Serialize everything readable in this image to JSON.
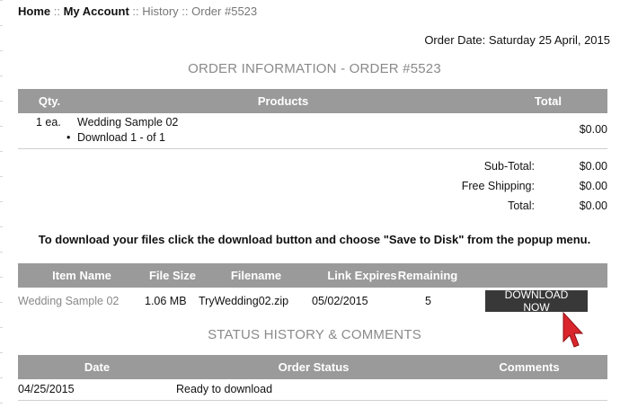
{
  "breadcrumb": {
    "home": "Home",
    "sep1": " :: ",
    "my_account": "My Account",
    "sep2": " :: ",
    "history": "History",
    "sep3": " :: ",
    "order": "Order #5523"
  },
  "order_date": "Order Date: Saturday 25 April, 2015",
  "order_info_title": "ORDER INFORMATION - ORDER #5523",
  "products_table": {
    "headers": {
      "qty": "Qty.",
      "products": "Products",
      "total": "Total"
    },
    "row": {
      "qty": "1 ea.",
      "name": "Wedding Sample 02",
      "bullet": "•",
      "sub": "Download 1 - of 1",
      "total": "$0.00"
    }
  },
  "totals": [
    {
      "label": "Sub-Total:",
      "value": "$0.00"
    },
    {
      "label": "Free Shipping:",
      "value": "$0.00"
    },
    {
      "label": "Total:",
      "value": "$0.00"
    }
  ],
  "instruction": "To download your files click the download button and choose \"Save to Disk\" from the popup menu.",
  "downloads_table": {
    "headers": {
      "item": "Item Name",
      "size": "File Size",
      "filename": "Filename",
      "expires": "Link Expires",
      "remaining": "Remaining"
    },
    "row": {
      "item": "Wedding Sample 02",
      "size": "1.06 MB",
      "filename": "TryWedding02.zip",
      "expires": "05/02/2015",
      "remaining": "5"
    },
    "button": "DOWNLOAD NOW"
  },
  "status_title": "STATUS HISTORY & COMMENTS",
  "status_table": {
    "headers": {
      "date": "Date",
      "status": "Order Status",
      "comments": "Comments"
    },
    "row": {
      "date": "04/25/2015",
      "status": "Ready to download",
      "comments": ""
    }
  },
  "colors": {
    "header_bar": "#9a9a9a",
    "button": "#383838",
    "arrow": "#d9262c"
  },
  "icons": {
    "cursor": "arrow-cursor-icon"
  }
}
